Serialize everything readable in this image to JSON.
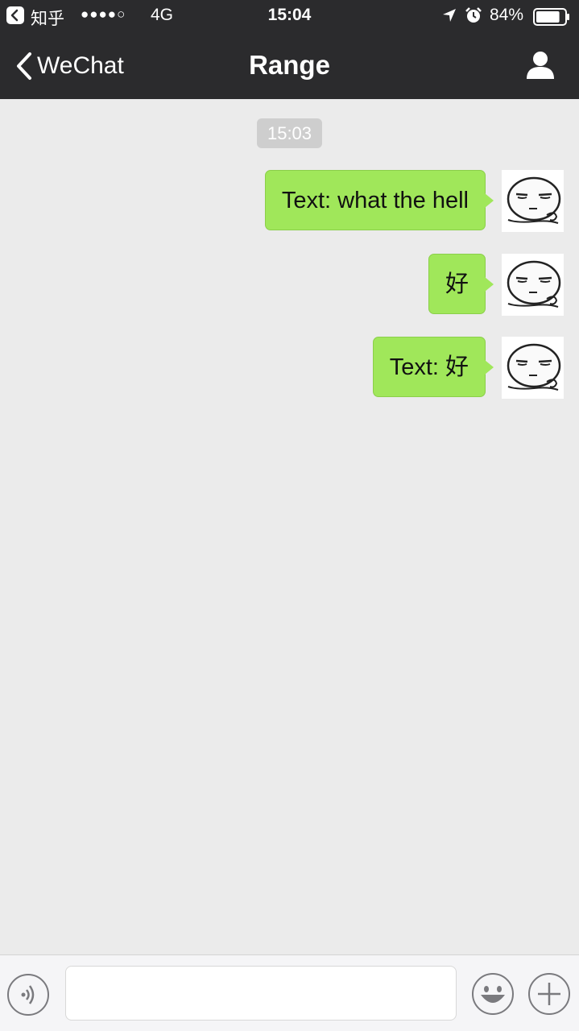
{
  "status_bar": {
    "carrier": "知乎",
    "signal": "●●●●○",
    "network": "4G",
    "time": "15:04",
    "battery": "84%",
    "battery_level": 0.84
  },
  "nav": {
    "back_label": "WeChat",
    "title": "Range"
  },
  "chat": {
    "timestamp": "15:03",
    "messages": [
      {
        "text": "Text: what the hell",
        "sender": "self"
      },
      {
        "text": "好",
        "sender": "self"
      },
      {
        "text": "Text: 好",
        "sender": "self"
      }
    ]
  },
  "input": {
    "value": "",
    "placeholder": ""
  },
  "colors": {
    "bar_bg": "#2b2b2d",
    "chat_bg": "#ebebeb",
    "bubble_self": "#a0e75a",
    "timestamp_bg": "#cecece"
  }
}
